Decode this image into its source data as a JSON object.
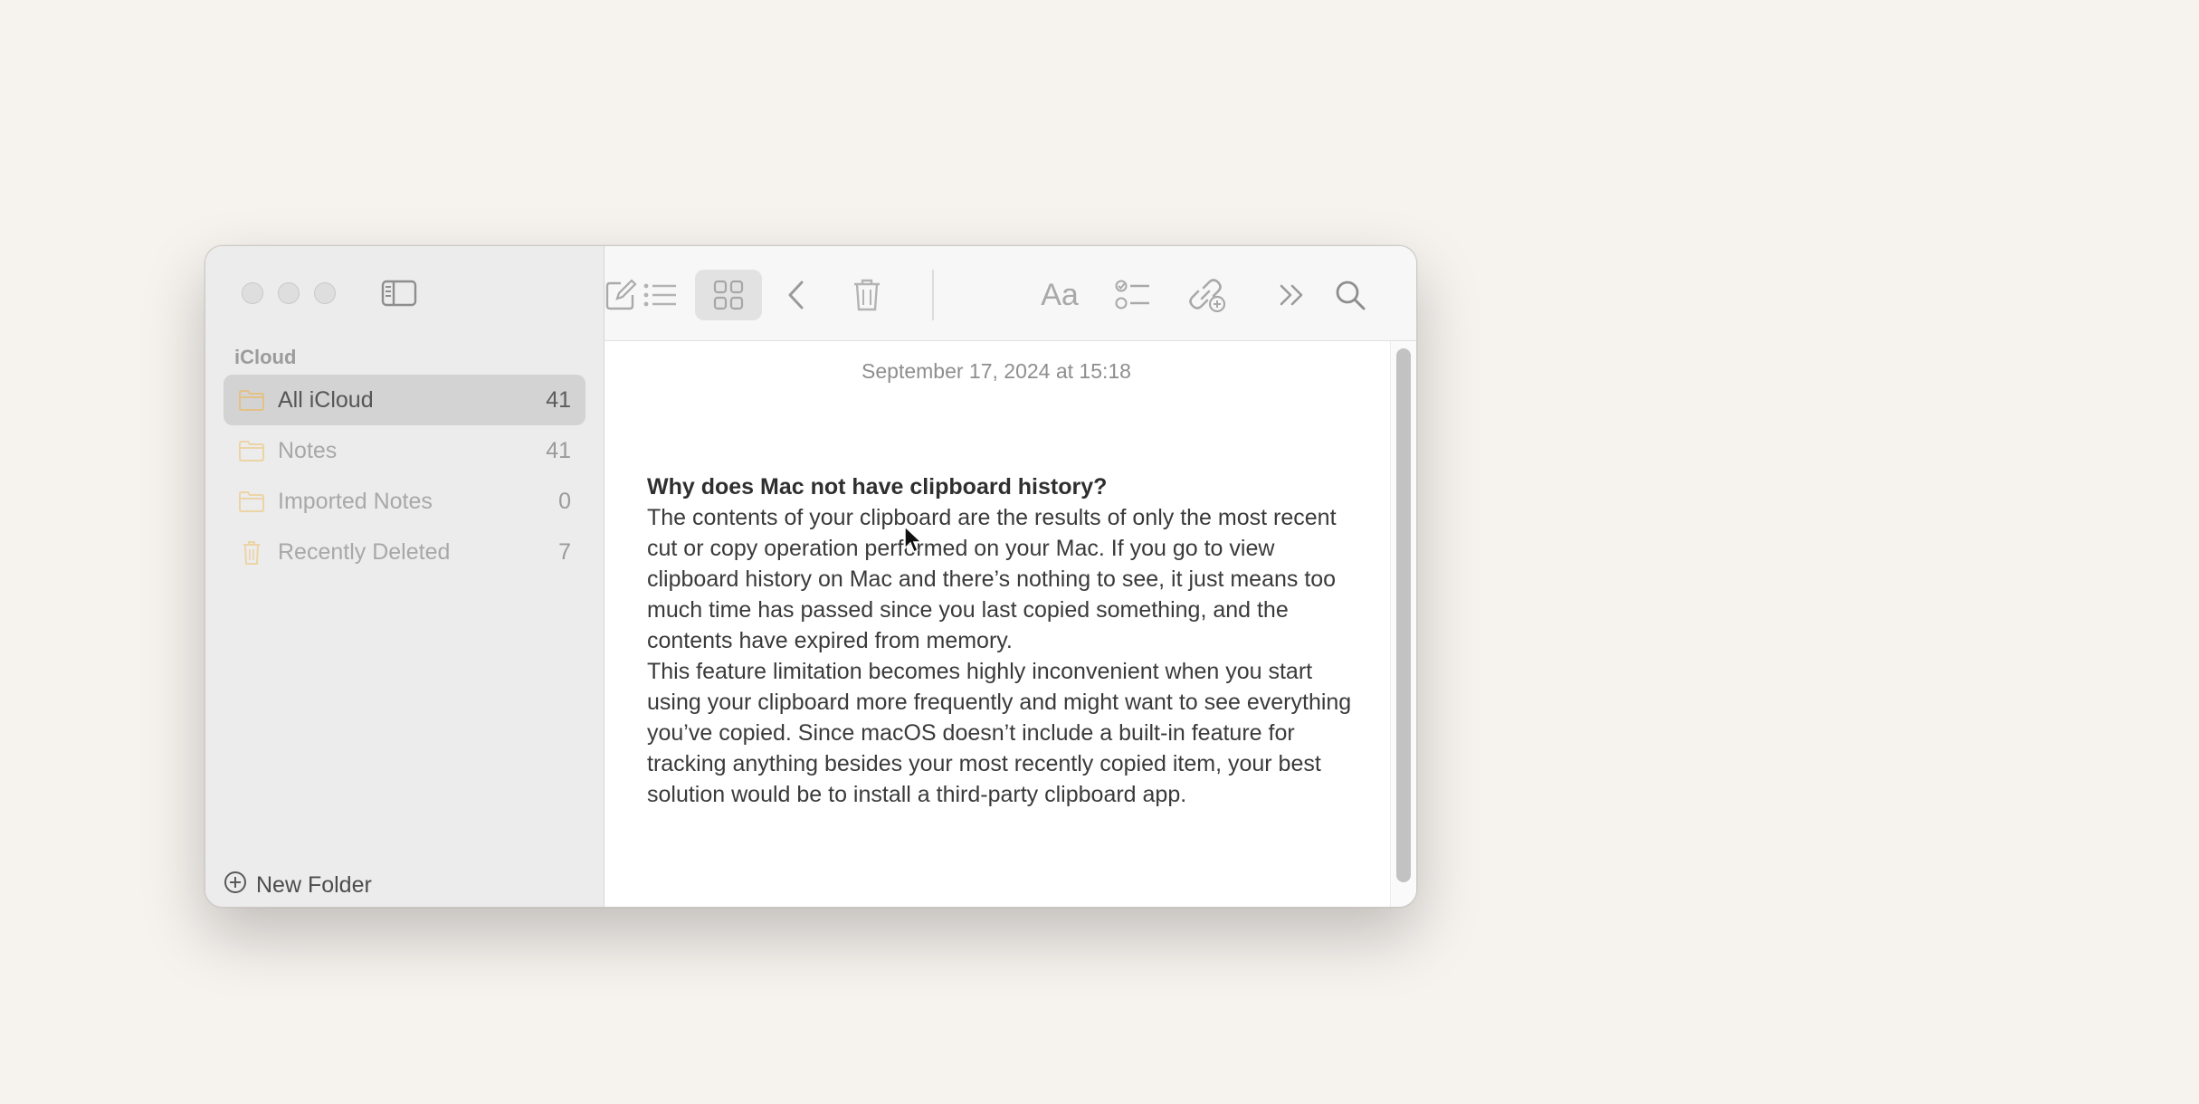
{
  "sidebar": {
    "section_label": "iCloud",
    "folders": [
      {
        "name": "All iCloud",
        "count": "41",
        "icon": "folder-icon",
        "selected": true
      },
      {
        "name": "Notes",
        "count": "41",
        "icon": "folder-icon",
        "selected": false
      },
      {
        "name": "Imported Notes",
        "count": "0",
        "icon": "folder-icon",
        "selected": false
      },
      {
        "name": "Recently Deleted",
        "count": "7",
        "icon": "trash-icon",
        "selected": false
      }
    ],
    "new_folder_label": "New Folder"
  },
  "toolbar": {
    "buttons": [
      "list-view-icon",
      "gallery-view-icon",
      "back-icon",
      "delete-icon",
      "compose-icon",
      "format-icon",
      "checklist-icon",
      "link-icon",
      "more-icon",
      "search-icon"
    ],
    "format_label": "Aa",
    "active_view": "gallery"
  },
  "note": {
    "date": "September 17, 2024 at 15:18",
    "title": "Why does Mac not have clipboard history?",
    "paragraph1": "The contents of your clipboard are the results of only the most recent cut or copy operation performed on your Mac. If you go to view clipboard history on Mac and there’s nothing to see, it just means too much time has passed since you last copied something, and the contents have expired from memory.",
    "paragraph2": "This feature limitation becomes highly inconvenient when you start using your clipboard more frequently and might want to see everything you’ve copied. Since macOS doesn’t include a built-in feature for tracking anything besides your most recently copied item, your best solution would be to install a third-party clipboard app."
  },
  "colors": {
    "desktop": "#f6f2ee",
    "sidebar": "#ececec",
    "folder_icon": "#e8c98a",
    "selected_row": "#d3d3d3"
  }
}
